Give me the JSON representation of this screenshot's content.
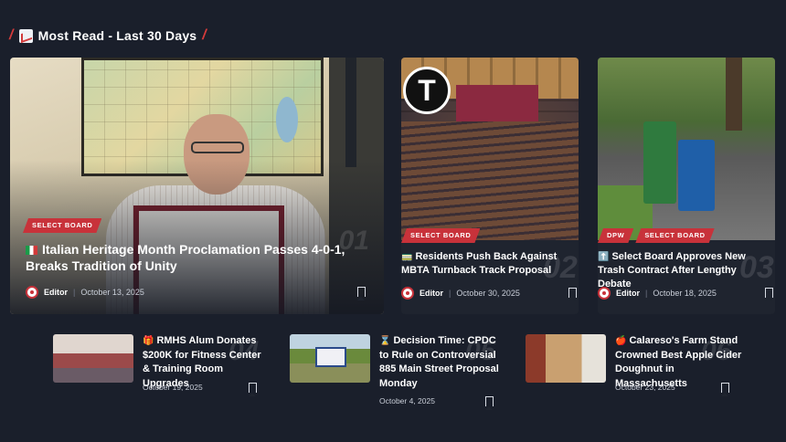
{
  "section": {
    "title": "Most Read - Last 30 Days",
    "icon": "chart-up-icon"
  },
  "featured": [
    {
      "rank": "01",
      "badges": [
        "SELECT BOARD"
      ],
      "title_emoji": "🇮🇹",
      "title": "Italian Heritage Month Proclamation Passes 4-0-1, Breaks Tradition of Unity",
      "author": "Editor",
      "date": "October 13, 2025"
    },
    {
      "rank": "02",
      "badges": [
        "SELECT BOARD"
      ],
      "title_emoji": "🚃",
      "title": "Residents Push Back Against MBTA Turnback Track Proposal",
      "author": "Editor",
      "date": "October 30, 2025"
    },
    {
      "rank": "03",
      "badges": [
        "DPW",
        "SELECT BOARD"
      ],
      "title_emoji": "⬆️",
      "title": "Select Board Approves New Trash Contract After Lengthy Debate",
      "author": "Editor",
      "date": "October 18, 2025"
    }
  ],
  "list": [
    {
      "rank": "04",
      "title_emoji": "🎁",
      "title": "RMHS Alum Donates $200K for Fitness Center & Training Room Upgrades",
      "date": "October 19, 2025"
    },
    {
      "rank": "05",
      "title_emoji": "⌛",
      "title": "Decision Time: CPDC to Rule on Controversial 885 Main Street Proposal Monday",
      "date": "October 4, 2025"
    },
    {
      "rank": "06",
      "title_emoji": "🍎",
      "title": "Calareso's Farm Stand Crowned Best Apple Cider Doughnut in Massachusetts",
      "date": "October 23, 2025"
    }
  ],
  "colors": {
    "background": "#1a1f2b",
    "accent": "#c8323a",
    "text": "#ffffff",
    "meta": "#c9ced8"
  }
}
